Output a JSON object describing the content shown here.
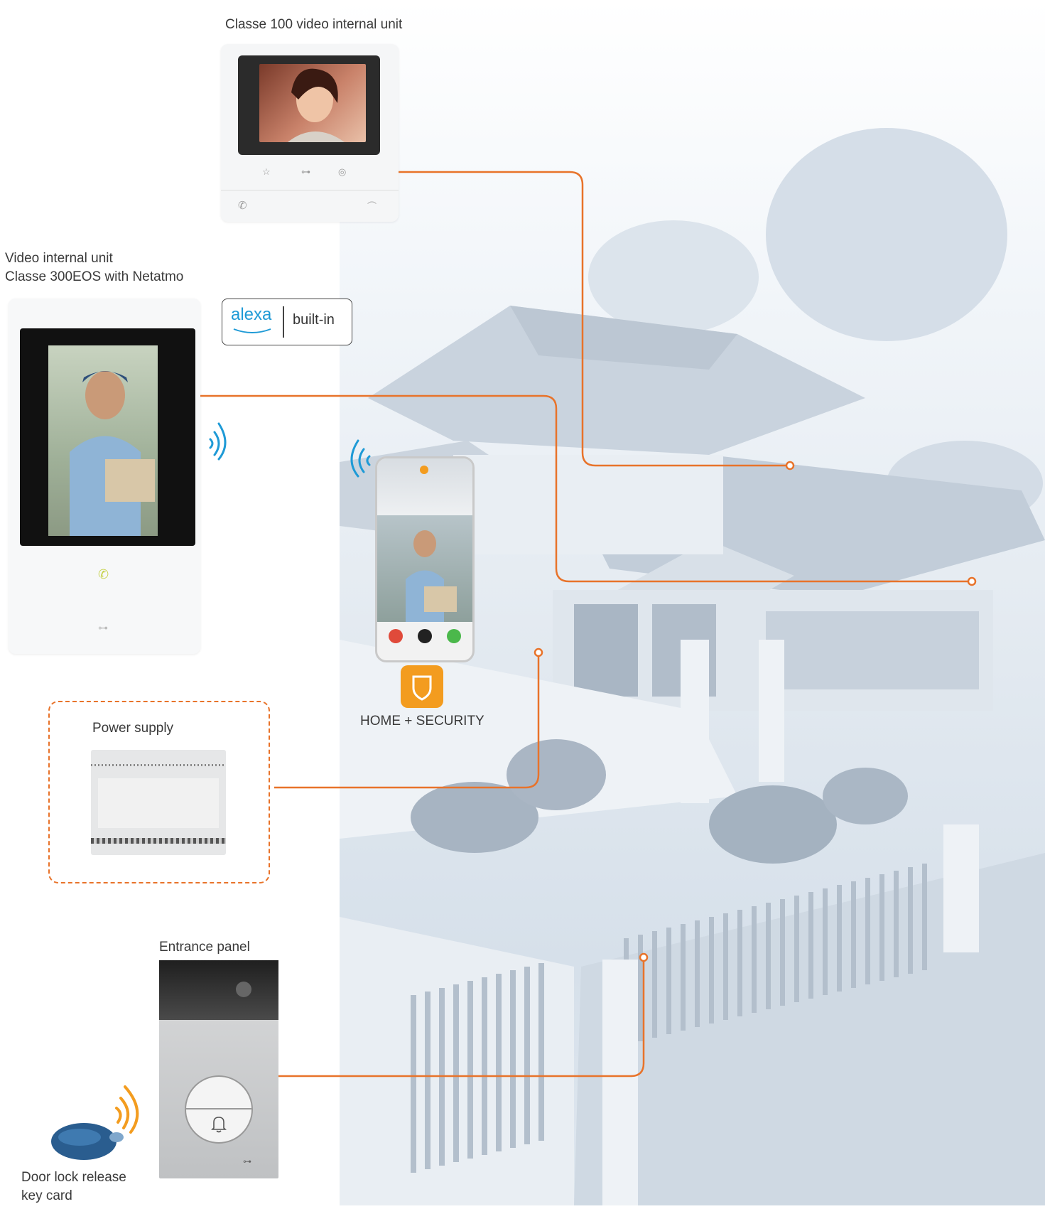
{
  "labels": {
    "classe100": "Classe 100 video internal unit",
    "classe300_line1": "Video internal unit",
    "classe300_line2": "Classe 300EOS with Netatmo",
    "alexa_word": "alexa",
    "builtin": "built-in",
    "app_name": "HOME + SECURITY",
    "power_supply": "Power supply",
    "entrance_panel": "Entrance panel",
    "keycard_line1": "Door lock release",
    "keycard_line2": "key card"
  },
  "colors": {
    "connector": "#e8732a",
    "wifi": "#1e9ad6",
    "app_icon": "#f39c1f",
    "rfid_waves": "#f39c1f",
    "keycard": "#2a5d8f"
  },
  "icons": [
    "wifi-waves-icon",
    "shield-icon",
    "bell-icon",
    "phone-icon",
    "key-icon",
    "star-icon",
    "eye-icon",
    "hangup-icon"
  ]
}
